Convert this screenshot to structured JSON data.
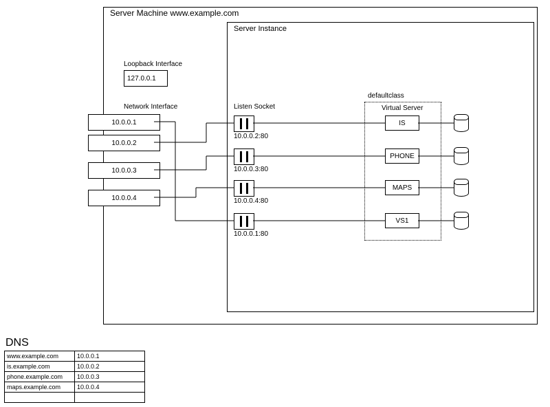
{
  "server_machine": {
    "title": "Server Machine www.example.com"
  },
  "server_instance": {
    "title": "Server Instance"
  },
  "loopback": {
    "heading": "Loopback Interface",
    "ip": "127.0.0.1"
  },
  "network_interface": {
    "heading": "Network Interface",
    "ips": [
      "10.0.0.1",
      "10.0.0.2",
      "10.0.0.3",
      "10.0.0.4"
    ]
  },
  "listen_socket": {
    "heading": "Listen Socket",
    "addrs": [
      "10.0.0.2:80",
      "10.0.0.3:80",
      "10.0.0.4:80",
      "10.0.0.1:80"
    ]
  },
  "defaultclass": {
    "heading": "defaultclass"
  },
  "virtual_server": {
    "heading": "Virtual Server",
    "names": [
      "IS",
      "PHONE",
      "MAPS",
      "VS1"
    ]
  },
  "dns": {
    "heading": "DNS",
    "rows": [
      {
        "host": "www.example.com",
        "ip": "10.0.0.1"
      },
      {
        "host": "is.example.com",
        "ip": "10.0.0.2"
      },
      {
        "host": "phone.example.com",
        "ip": "10.0.0.3"
      },
      {
        "host": "maps.example.com",
        "ip": "10.0.0.4"
      },
      {
        "host": "",
        "ip": ""
      }
    ]
  }
}
